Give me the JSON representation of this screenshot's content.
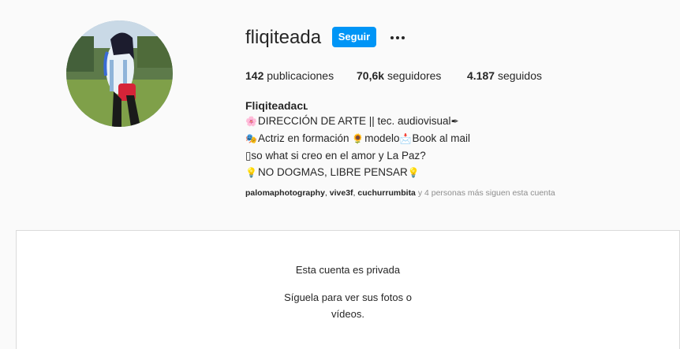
{
  "profile": {
    "username": "fliqiteada",
    "follow_label": "Seguir",
    "more_icon": "more-options-icon"
  },
  "stats": {
    "posts_count": "142",
    "posts_label": "publicaciones",
    "followers_count": "70,6k",
    "followers_label": "seguidores",
    "following_count": "4.187",
    "following_label": "seguidos"
  },
  "bio": {
    "full_name": "Fliqiteadaᴄʟ",
    "lines": [
      {
        "emoji": "🌸",
        "text": "DIRECCIÓN DE ARTE || tec. audiovisual",
        "trail": "✒"
      },
      {
        "emoji": "🎭",
        "text": "Actriz en formación ",
        "mid_emoji": "🌻",
        "mid_text": "modelo",
        "mid_emoji2": "📩",
        "tail_text": "Book al mail"
      },
      {
        "emoji": "",
        "text": "▯so what si creo en el amor y La Paz?"
      },
      {
        "emoji": "💡",
        "text": "NO DOGMAS, LIBRE PENSAR",
        "trail": "💡"
      }
    ]
  },
  "followed_by": {
    "accounts": [
      "palomaphotography",
      "vive3f",
      "cuchurrumbita"
    ],
    "separator": ", ",
    "suffix": " y 4 personas más siguen esta cuenta"
  },
  "private": {
    "title": "Esta cuenta es privada",
    "subtitle": "Síguela para ver sus fotos o vídeos."
  },
  "colors": {
    "accent": "#0095f6",
    "background": "#fafafa",
    "text": "#262626",
    "muted": "#8e8e8e"
  }
}
